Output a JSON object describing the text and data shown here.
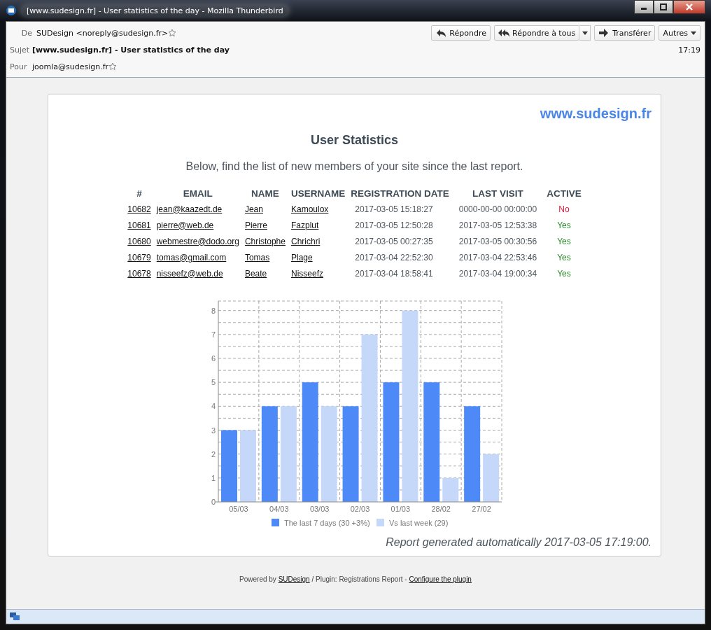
{
  "window": {
    "title": "[www.sudesign.fr] - User statistics of the day - Mozilla Thunderbird"
  },
  "header": {
    "from_label": "De",
    "from": "SUDesign <noreply@sudesign.fr>",
    "subject_label": "Sujet",
    "subject": "[www.sudesign.fr] - User statistics of the day",
    "time": "17:19",
    "to_label": "Pour",
    "to": "joomla@sudesign.fr",
    "buttons": [
      {
        "kind": "reply",
        "label": "Répondre"
      },
      {
        "kind": "reply-all",
        "label": "Répondre à tous"
      },
      {
        "kind": "forward",
        "label": "Transférer"
      },
      {
        "kind": "more",
        "label": "Autres"
      }
    ]
  },
  "report": {
    "site": "www.sudesign.fr",
    "title": "User Statistics",
    "intro": "Below, find the list of new members of your site since the last report.",
    "table": {
      "columns": [
        "#",
        "EMAIL",
        "NAME",
        "USERNAME",
        "REGISTRATION DATE",
        "LAST VISIT",
        "ACTIVE"
      ],
      "rows": [
        {
          "id": "10682",
          "email": "jean@kaazedt.de",
          "name": "Jean",
          "username": "Kamoulox",
          "registered": "2017-03-05 15:18:27",
          "last_visit": "0000-00-00 00:00:00",
          "active": false,
          "active_label": "No"
        },
        {
          "id": "10681",
          "email": "pierre@web.de",
          "name": "Pierre",
          "username": "Fazplut",
          "registered": "2017-03-05 12:50:28",
          "last_visit": "2017-03-05 12:53:38",
          "active": true,
          "active_label": "Yes"
        },
        {
          "id": "10680",
          "email": "webmestre@dodo.org",
          "name": "Christophe",
          "username": "Chrichri",
          "registered": "2017-03-05 00:27:35",
          "last_visit": "2017-03-05 00:30:56",
          "active": true,
          "active_label": "Yes"
        },
        {
          "id": "10679",
          "email": "tomas@gmail.com",
          "name": "Tomas",
          "username": "Plage",
          "registered": "2017-03-04 22:52:30",
          "last_visit": "2017-03-04 22:53:46",
          "active": true,
          "active_label": "Yes"
        },
        {
          "id": "10678",
          "email": "nisseefz@web.de",
          "name": "Beate",
          "username": "Nisseefz",
          "registered": "2017-03-04 18:58:41",
          "last_visit": "2017-03-04 19:00:34",
          "active": true,
          "active_label": "Yes"
        }
      ]
    },
    "chart_data": {
      "type": "bar",
      "categories": [
        "05/03",
        "04/03",
        "03/03",
        "02/03",
        "01/03",
        "28/02",
        "27/02"
      ],
      "series": [
        {
          "name": "The last 7 days (30 +3%)",
          "color": "#4d8af8",
          "values": [
            3,
            4,
            5,
            4,
            5,
            5,
            4
          ]
        },
        {
          "name": "Vs last week (29)",
          "color": "#c6d8fa",
          "values": [
            3,
            4,
            4,
            7,
            8,
            1,
            2
          ]
        }
      ],
      "grid": true,
      "legend": true,
      "ylim": [
        0,
        8.4
      ],
      "yticks": [
        0,
        1,
        2,
        3,
        4,
        5,
        6,
        7,
        8
      ]
    },
    "generated": "Report generated automatically 2017-03-05 17:19:00."
  },
  "footer": {
    "prefix": "Powered by",
    "link": "SUDesign",
    "middle": "/ Plugin: Registrations Report -",
    "config_link": "Configure the plugin"
  }
}
